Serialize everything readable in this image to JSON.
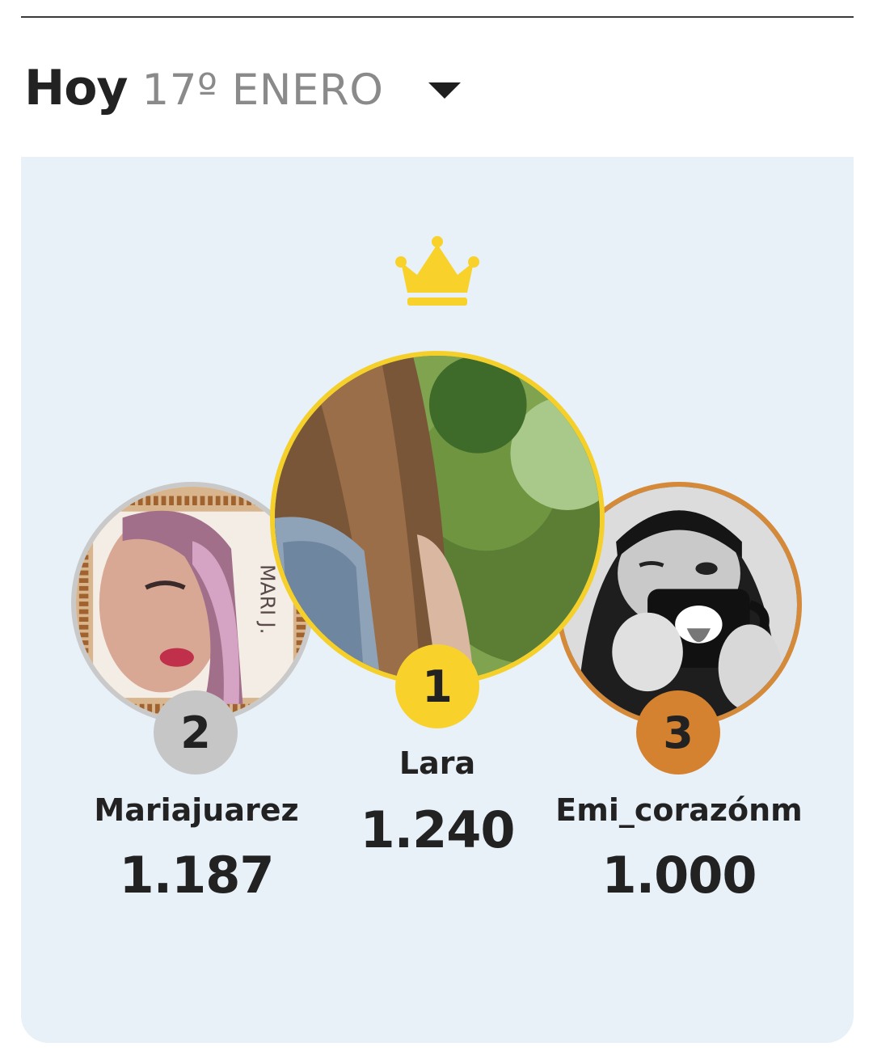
{
  "header": {
    "today_label": "Hoy",
    "date_label": "17º ENERO",
    "dropdown_icon": "caret-down-icon"
  },
  "leaderboard": {
    "crown_icon": "crown-icon",
    "crown_color": "#f8d22b",
    "entries": [
      {
        "rank": "1",
        "name": "Lara",
        "score": "1.240",
        "color": "#f8d22b"
      },
      {
        "rank": "2",
        "name": "Mariajuarez",
        "score": "1.187",
        "color": "#c6c6c6"
      },
      {
        "rank": "3",
        "name": "Emi_corazónm",
        "score": "1.000",
        "color": "#d4822f"
      }
    ],
    "avatar_2_overlay_text": "MARI J."
  }
}
